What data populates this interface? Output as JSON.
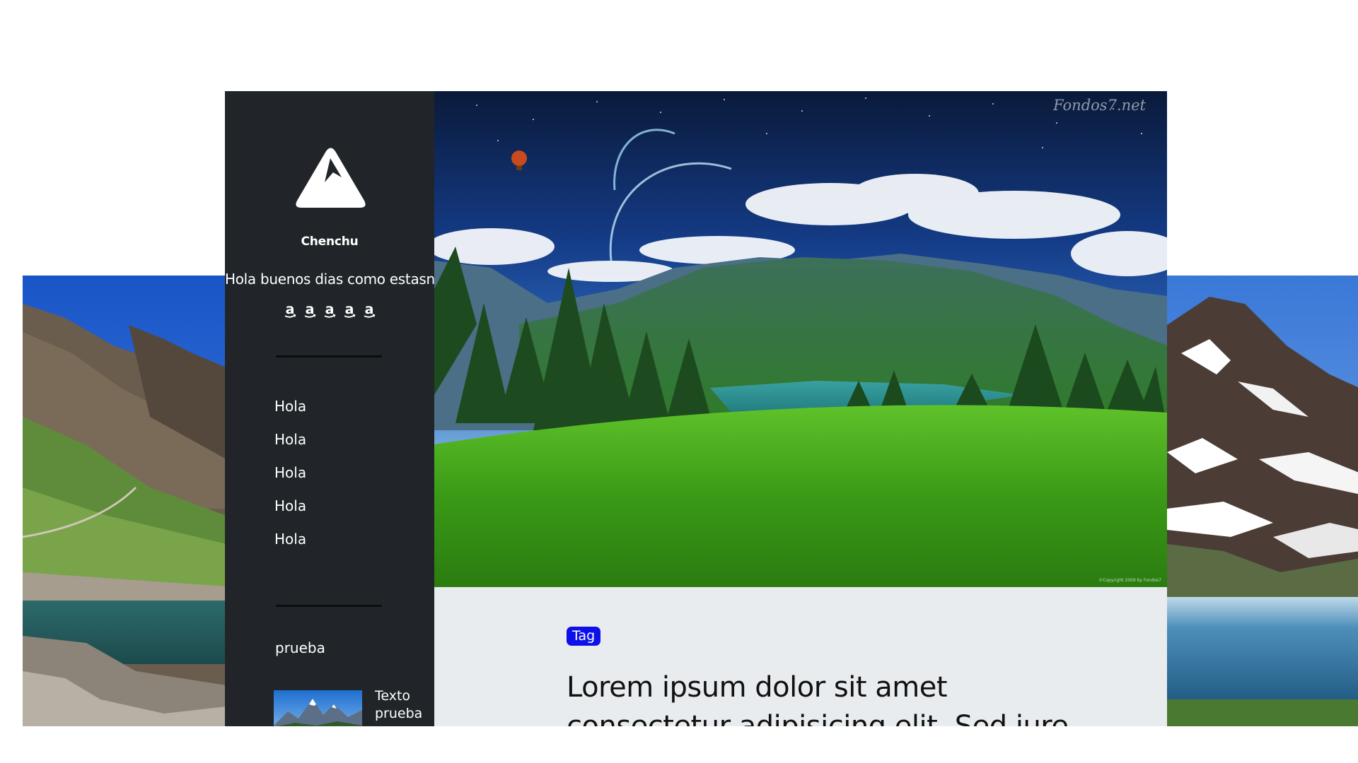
{
  "sidebar": {
    "logo_icon": "mountain-triangle-logo",
    "brand_name": "Chenchu",
    "tagline": "Hola buenos dias como estasn",
    "social_icons": [
      {
        "icon": "amazon-icon",
        "label": "a"
      },
      {
        "icon": "amazon-icon",
        "label": "a"
      },
      {
        "icon": "amazon-icon",
        "label": "a"
      },
      {
        "icon": "amazon-icon",
        "label": "a"
      },
      {
        "icon": "amazon-icon",
        "label": "a"
      }
    ],
    "nav_items": [
      {
        "label": "Hola"
      },
      {
        "label": "Hola"
      },
      {
        "label": "Hola"
      },
      {
        "label": "Hola"
      },
      {
        "label": "Hola"
      }
    ],
    "section_title": "prueba",
    "post": {
      "text": "Texto prueba"
    }
  },
  "hero": {
    "watermark": "Fondos7.net",
    "copyright": "©Copyright 2009 by Fondos7"
  },
  "article": {
    "tag": "Tag",
    "title": "Lorem ipsum dolor sit amet consectetur adipisicing elit. Sed iure"
  },
  "colors": {
    "sidebar_bg": "#212529",
    "article_bg": "#e9ecef",
    "tag_bg": "#0d10e8"
  }
}
